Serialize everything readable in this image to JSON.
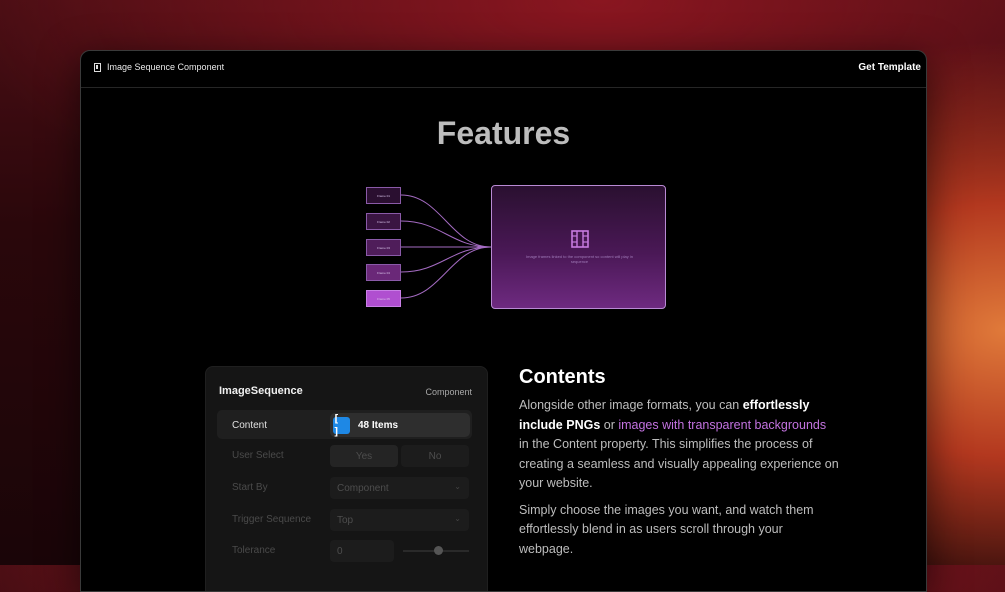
{
  "header": {
    "brand": "Image Sequence Component",
    "cta": "Get Template"
  },
  "hero": {
    "title": "Features"
  },
  "diagram": {
    "frames": [
      "Frame 01",
      "Frame 02",
      "Frame 03",
      "Frame 04",
      "Frame 05"
    ],
    "caption": "Image frames linked to the component so content will play in sequence",
    "colors": {
      "frame_border": "#8a5aa8",
      "link": "#a46bc2",
      "active_frame": "#b04fd0"
    }
  },
  "panel": {
    "title": "ImageSequence",
    "subtitle": "Component",
    "rows": [
      {
        "label": "Content",
        "value": "48 Items"
      },
      {
        "label": "User Select",
        "options": [
          "Yes",
          "No"
        ]
      },
      {
        "label": "Start By",
        "value": "Component"
      },
      {
        "label": "Trigger Sequence",
        "value": "Top"
      },
      {
        "label": "Tolerance",
        "value": "0"
      }
    ]
  },
  "contents": {
    "heading": "Contents",
    "p1": {
      "t1": "Alongside other image formats, you can ",
      "b1": "effortlessly include PNGs",
      "t2": " or ",
      "link": "images with transparent backgrounds",
      "t3": " in the Content property. This simplifies the process of creating a seamless and visually appealing experience on your website."
    },
    "p2": "Simply choose the images you want, and watch them effortlessly blend in as users scroll through your webpage."
  }
}
